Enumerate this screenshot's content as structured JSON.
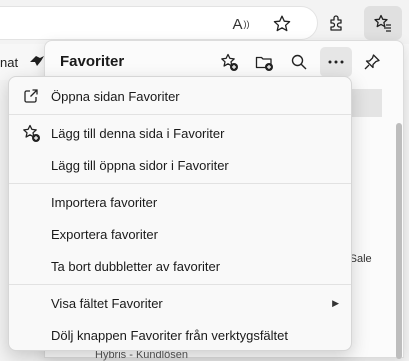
{
  "toolbar": {
    "read_aloud_glyph": "A",
    "icons": [
      "read-aloud-icon",
      "favorite-star-icon",
      "extensions-icon",
      "favorites-hub-icon"
    ]
  },
  "favbar": {
    "partial_label": "nat"
  },
  "panel": {
    "title": "Favoriter",
    "header_icons": [
      "add-favorite-icon",
      "add-folder-icon",
      "search-icon",
      "more-options-icon",
      "pin-icon"
    ],
    "background_items": [
      "al Sale",
      "Hybris - Kundlösen"
    ]
  },
  "menu": {
    "items": [
      {
        "label": "Öppna sidan Favoriter",
        "icon": "open-external-icon"
      },
      {
        "label": "Lägg till denna sida i Favoriter",
        "icon": "add-favorite-icon"
      },
      {
        "label": "Lägg till öppna sidor i Favoriter",
        "icon": ""
      },
      {
        "label": "Importera favoriter",
        "icon": ""
      },
      {
        "label": "Exportera favoriter",
        "icon": ""
      },
      {
        "label": "Ta bort dubbletter av favoriter",
        "icon": ""
      },
      {
        "label": "Visa fältet Favoriter",
        "icon": "",
        "submenu": true
      },
      {
        "label": "Dölj knappen Favoriter från verktygsfältet",
        "icon": ""
      }
    ],
    "submenu_arrow": "▶"
  }
}
